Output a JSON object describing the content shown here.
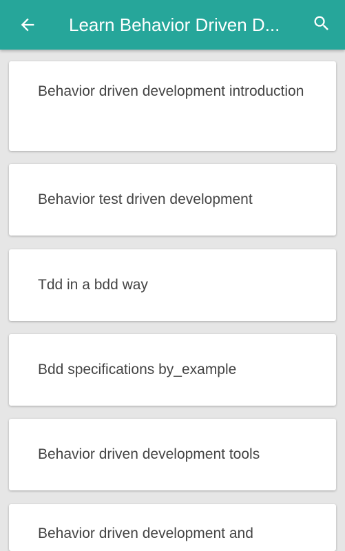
{
  "appbar": {
    "title": "Learn Behavior Driven D...",
    "back_icon": "arrow-left-icon",
    "search_icon": "search-icon",
    "color": "#26a69a"
  },
  "list": {
    "items": [
      {
        "label": "Behavior driven development introduction"
      },
      {
        "label": "Behavior test driven development"
      },
      {
        "label": "Tdd in a bdd way"
      },
      {
        "label": "Bdd specifications by_example"
      },
      {
        "label": "Behavior driven development tools"
      },
      {
        "label": "Behavior driven development and"
      }
    ]
  }
}
